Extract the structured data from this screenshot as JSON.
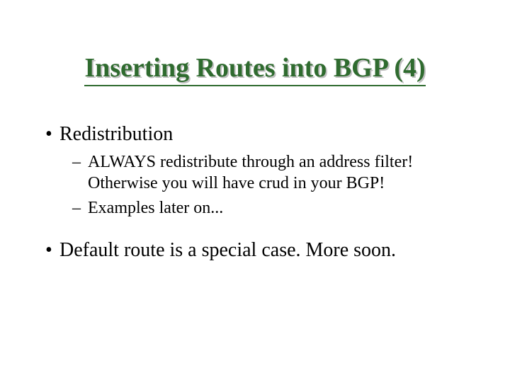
{
  "slide": {
    "title": "Inserting Routes into BGP (4)",
    "bullets": [
      {
        "text": "Redistribution",
        "sub": [
          "ALWAYS redistribute through an address filter! Otherwise you will have crud in your BGP!",
          "Examples later on..."
        ]
      },
      {
        "text": "Default route is a special case.  More soon.",
        "sub": []
      }
    ],
    "markers": {
      "bullet": "•",
      "dash": "–"
    },
    "colors": {
      "title": "#2f6b2f",
      "shadow": "#c0c0c0",
      "text": "#000000",
      "background": "#ffffff"
    }
  }
}
